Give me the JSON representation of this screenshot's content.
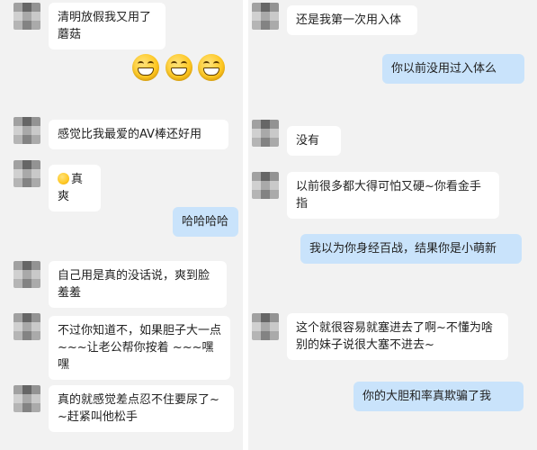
{
  "left_chat": {
    "messages": [
      {
        "text": "清明放假我又用了蘑菇"
      },
      {
        "emojis": [
          "grin-emoji",
          "grin-emoji",
          "grin-emoji"
        ]
      },
      {
        "text": "感觉比我最爱的AV棒还好用"
      },
      {
        "text": "真爽"
      },
      {
        "text": "哈哈哈哈"
      },
      {
        "text": "自己用是真的没话说，爽到脸羞羞"
      },
      {
        "text": "不过你知道不，如果胆子大一点 ~~~让老公帮你按着 ~~~嘿嘿"
      },
      {
        "text": "真的就感觉差点忍不住要尿了~~赶紧叫他松手"
      }
    ]
  },
  "right_chat": {
    "messages": [
      {
        "text": "还是我第一次用入体"
      },
      {
        "text": "你以前没用过入体么"
      },
      {
        "text": "没有"
      },
      {
        "text": "以前很多都大得可怕又硬~你看金手指"
      },
      {
        "text": "我以为你身经百战，结果你是小萌新"
      },
      {
        "text": "这个就很容易就塞进去了啊~不懂为啥别的妹子说很大塞不进去~"
      },
      {
        "text": "你的大胆和率真欺骗了我"
      }
    ]
  }
}
